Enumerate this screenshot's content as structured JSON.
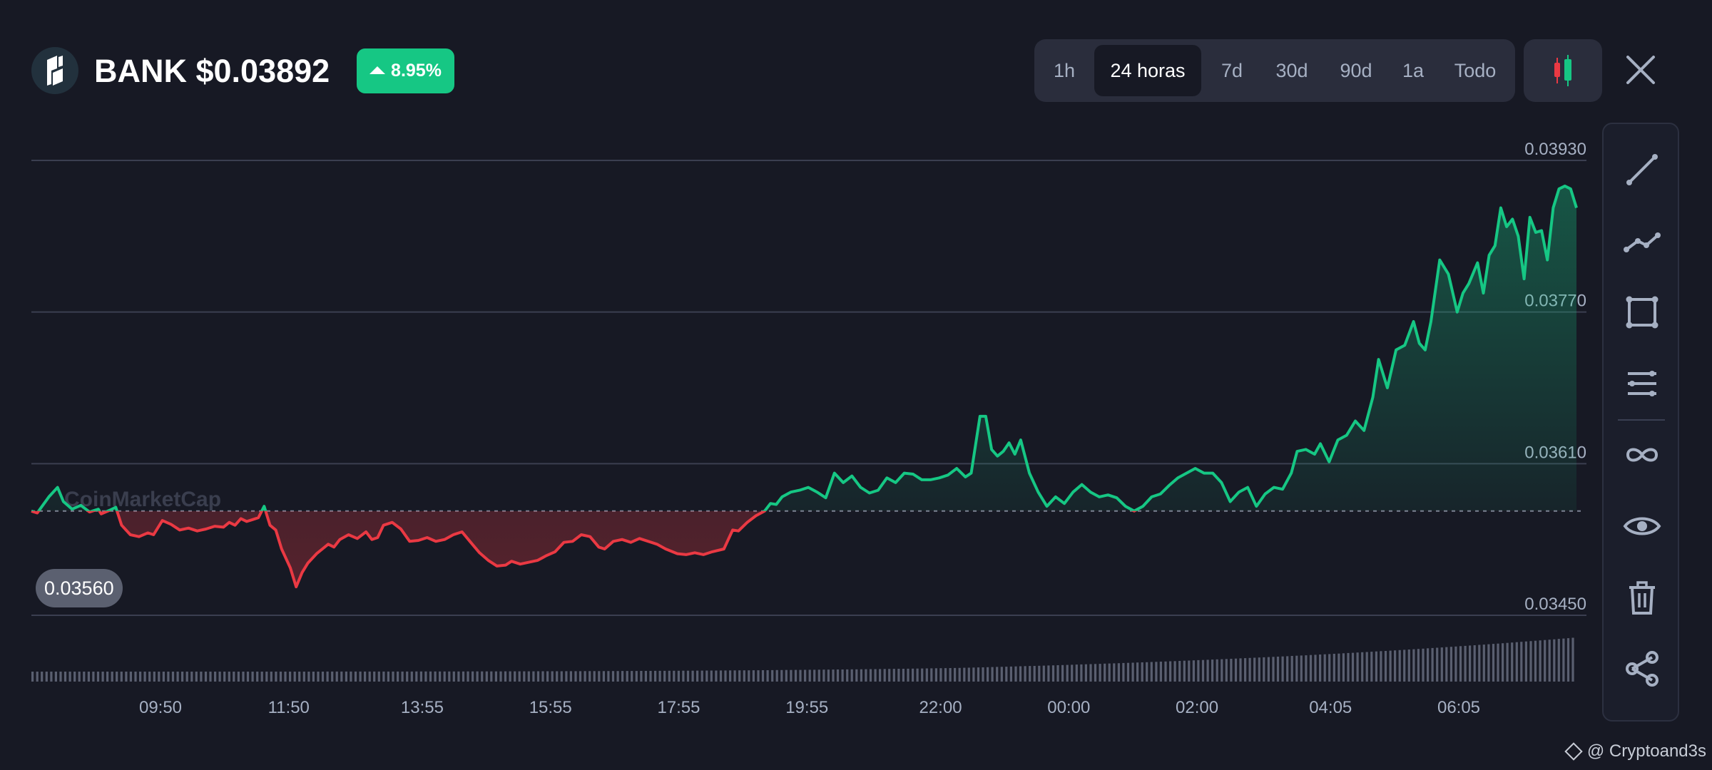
{
  "asset": {
    "ticker_price": "BANK $0.03892",
    "change": "8.95%",
    "logo_icon": "bank-logo-icon"
  },
  "range_tabs": [
    {
      "label": "1h",
      "active": false
    },
    {
      "label": "24 horas",
      "active": true
    },
    {
      "label": "7d",
      "active": false
    },
    {
      "label": "30d",
      "active": false
    },
    {
      "label": "90d",
      "active": false
    },
    {
      "label": "1a",
      "active": false
    },
    {
      "label": "Todo",
      "active": false
    }
  ],
  "controls": {
    "candle_icon": "candlestick-icon",
    "close_icon": "close-icon"
  },
  "toolbar": [
    "trend-line-icon",
    "polyline-icon",
    "rectangle-icon",
    "parallel-lines-icon",
    "infinity-icon",
    "eye-icon",
    "trash-icon",
    "share-icon"
  ],
  "chart_data": {
    "type": "area",
    "watermark": "CoinMarketCap",
    "baseline": 0.0356,
    "baseline_label": "0.03560",
    "y_ticks": [
      "0.03930",
      "0.03770",
      "0.03610",
      "0.03450"
    ],
    "y_tick_values": [
      0.0393,
      0.0377,
      0.0361,
      0.0345
    ],
    "ylim": [
      0.0345,
      0.0393
    ],
    "x_ticks": [
      "09:50",
      "11:50",
      "13:55",
      "15:55",
      "17:55",
      "19:55",
      "22:00",
      "00:00",
      "02:00",
      "04:05",
      "06:05"
    ],
    "x_tick_hours": [
      2,
      4,
      6.083,
      8.083,
      10.083,
      12.083,
      14.167,
      16.167,
      18.167,
      20.25,
      22.25
    ],
    "xlim_hours": [
      0,
      24
    ],
    "series": [
      {
        "points": [
          [
            0.0,
            0.0356
          ],
          [
            0.1,
            0.03558
          ],
          [
            0.3,
            0.03575
          ],
          [
            0.45,
            0.03585
          ],
          [
            0.55,
            0.0357
          ],
          [
            0.7,
            0.03562
          ],
          [
            0.85,
            0.03566
          ],
          [
            1.0,
            0.03559
          ],
          [
            1.15,
            0.03562
          ],
          [
            1.2,
            0.03557
          ],
          [
            1.35,
            0.03561
          ],
          [
            1.45,
            0.03564
          ],
          [
            1.55,
            0.03545
          ],
          [
            1.7,
            0.03535
          ],
          [
            1.85,
            0.03533
          ],
          [
            2.0,
            0.03537
          ],
          [
            2.1,
            0.03535
          ],
          [
            2.25,
            0.0355
          ],
          [
            2.4,
            0.03546
          ],
          [
            2.55,
            0.0354
          ],
          [
            2.7,
            0.03542
          ],
          [
            2.85,
            0.03539
          ],
          [
            3.0,
            0.03541
          ],
          [
            3.15,
            0.03544
          ],
          [
            3.3,
            0.03543
          ],
          [
            3.4,
            0.03548
          ],
          [
            3.5,
            0.03545
          ],
          [
            3.6,
            0.03552
          ],
          [
            3.7,
            0.03549
          ],
          [
            3.8,
            0.03551
          ],
          [
            3.9,
            0.03553
          ],
          [
            4.0,
            0.03565
          ],
          [
            4.1,
            0.03545
          ],
          [
            4.2,
            0.0354
          ],
          [
            4.3,
            0.0352
          ],
          [
            4.45,
            0.035
          ],
          [
            4.55,
            0.0348
          ],
          [
            4.65,
            0.03495
          ],
          [
            4.75,
            0.03505
          ],
          [
            4.9,
            0.03515
          ],
          [
            5.0,
            0.0352
          ],
          [
            5.1,
            0.03525
          ],
          [
            5.2,
            0.03522
          ],
          [
            5.3,
            0.0353
          ],
          [
            5.45,
            0.03535
          ],
          [
            5.6,
            0.03531
          ],
          [
            5.75,
            0.03538
          ],
          [
            5.85,
            0.0353
          ],
          [
            5.95,
            0.03532
          ],
          [
            6.05,
            0.03545
          ],
          [
            6.2,
            0.03548
          ],
          [
            6.35,
            0.03541
          ],
          [
            6.5,
            0.03528
          ],
          [
            6.65,
            0.03529
          ],
          [
            6.8,
            0.03532
          ],
          [
            6.95,
            0.03528
          ],
          [
            7.1,
            0.0353
          ],
          [
            7.25,
            0.03535
          ],
          [
            7.4,
            0.03538
          ],
          [
            7.55,
            0.03527
          ],
          [
            7.7,
            0.03516
          ],
          [
            7.85,
            0.03508
          ],
          [
            8.0,
            0.03502
          ],
          [
            8.15,
            0.03503
          ],
          [
            8.25,
            0.03507
          ],
          [
            8.4,
            0.03504
          ],
          [
            8.55,
            0.03506
          ],
          [
            8.7,
            0.03508
          ],
          [
            8.85,
            0.03513
          ],
          [
            9.0,
            0.03517
          ],
          [
            9.15,
            0.03527
          ],
          [
            9.3,
            0.03528
          ],
          [
            9.45,
            0.03535
          ],
          [
            9.6,
            0.03533
          ],
          [
            9.75,
            0.03522
          ],
          [
            9.85,
            0.0352
          ],
          [
            10.0,
            0.03528
          ],
          [
            10.15,
            0.0353
          ],
          [
            10.3,
            0.03527
          ],
          [
            10.45,
            0.03531
          ],
          [
            10.6,
            0.03528
          ],
          [
            10.75,
            0.03525
          ],
          [
            10.9,
            0.0352
          ],
          [
            11.1,
            0.03515
          ],
          [
            11.25,
            0.03514
          ],
          [
            11.4,
            0.03516
          ],
          [
            11.55,
            0.03514
          ],
          [
            11.7,
            0.03517
          ],
          [
            11.9,
            0.0352
          ],
          [
            12.05,
            0.0354
          ],
          [
            12.15,
            0.03539
          ],
          [
            12.3,
            0.03548
          ],
          [
            12.45,
            0.03555
          ],
          [
            12.6,
            0.0356
          ],
          [
            12.7,
            0.03568
          ],
          [
            12.8,
            0.03567
          ],
          [
            12.9,
            0.03575
          ],
          [
            13.05,
            0.0358
          ],
          [
            13.2,
            0.03582
          ],
          [
            13.35,
            0.03585
          ],
          [
            13.5,
            0.0358
          ],
          [
            13.65,
            0.03574
          ],
          [
            13.8,
            0.036
          ],
          [
            13.95,
            0.0359
          ],
          [
            14.1,
            0.03597
          ],
          [
            14.25,
            0.03585
          ],
          [
            14.4,
            0.03579
          ],
          [
            14.55,
            0.03582
          ],
          [
            14.7,
            0.03595
          ],
          [
            14.85,
            0.0359
          ],
          [
            15.0,
            0.036
          ],
          [
            15.15,
            0.03599
          ],
          [
            15.3,
            0.03593
          ],
          [
            15.45,
            0.03593
          ],
          [
            15.6,
            0.03595
          ],
          [
            15.75,
            0.03598
          ],
          [
            15.9,
            0.03605
          ],
          [
            16.05,
            0.03596
          ],
          [
            16.15,
            0.036
          ],
          [
            16.3,
            0.0366
          ],
          [
            16.4,
            0.0366
          ],
          [
            16.5,
            0.03625
          ],
          [
            16.6,
            0.03618
          ],
          [
            16.7,
            0.03623
          ],
          [
            16.8,
            0.03632
          ],
          [
            16.9,
            0.0362
          ],
          [
            17.0,
            0.03635
          ],
          [
            17.15,
            0.036
          ],
          [
            17.3,
            0.0358
          ],
          [
            17.45,
            0.03565
          ],
          [
            17.6,
            0.03575
          ],
          [
            17.75,
            0.03568
          ],
          [
            17.9,
            0.0358
          ],
          [
            18.05,
            0.03588
          ],
          [
            18.2,
            0.0358
          ],
          [
            18.35,
            0.03575
          ],
          [
            18.5,
            0.03577
          ],
          [
            18.65,
            0.03574
          ],
          [
            18.8,
            0.03565
          ],
          [
            18.95,
            0.0356
          ],
          [
            19.1,
            0.03565
          ],
          [
            19.25,
            0.03575
          ],
          [
            19.4,
            0.03578
          ],
          [
            19.55,
            0.03587
          ],
          [
            19.7,
            0.03595
          ],
          [
            19.85,
            0.036
          ],
          [
            20.0,
            0.03605
          ],
          [
            20.15,
            0.036
          ],
          [
            20.3,
            0.036
          ],
          [
            20.45,
            0.0359
          ],
          [
            20.6,
            0.0357
          ],
          [
            20.75,
            0.0358
          ],
          [
            20.9,
            0.03585
          ],
          [
            21.05,
            0.03565
          ],
          [
            21.2,
            0.03578
          ],
          [
            21.35,
            0.03585
          ],
          [
            21.5,
            0.03583
          ],
          [
            21.65,
            0.036
          ],
          [
            21.75,
            0.03623
          ],
          [
            21.9,
            0.03625
          ],
          [
            22.05,
            0.0362
          ],
          [
            22.15,
            0.03631
          ],
          [
            22.3,
            0.03612
          ],
          [
            22.45,
            0.03635
          ],
          [
            22.6,
            0.0364
          ],
          [
            22.75,
            0.03655
          ],
          [
            22.9,
            0.03645
          ],
          [
            23.05,
            0.0368
          ],
          [
            23.15,
            0.0372
          ],
          [
            23.3,
            0.0369
          ],
          [
            23.45,
            0.0373
          ],
          [
            23.6,
            0.03735
          ],
          [
            23.75,
            0.0376
          ],
          [
            23.85,
            0.03737
          ],
          [
            23.95,
            0.0373
          ],
          [
            24.05,
            0.0376
          ],
          [
            24.2,
            0.03825
          ],
          [
            24.35,
            0.0381
          ],
          [
            24.5,
            0.0377
          ],
          [
            24.6,
            0.0379
          ],
          [
            24.7,
            0.038
          ],
          [
            24.85,
            0.03822
          ],
          [
            24.95,
            0.0379
          ],
          [
            25.05,
            0.0383
          ],
          [
            25.15,
            0.0384
          ],
          [
            25.25,
            0.0388
          ],
          [
            25.35,
            0.0386
          ],
          [
            25.45,
            0.03868
          ],
          [
            25.55,
            0.0385
          ],
          [
            25.65,
            0.03805
          ],
          [
            25.75,
            0.0387
          ],
          [
            25.85,
            0.03854
          ],
          [
            25.95,
            0.03856
          ],
          [
            26.05,
            0.03825
          ],
          [
            26.15,
            0.0388
          ],
          [
            26.25,
            0.039
          ],
          [
            26.35,
            0.03903
          ],
          [
            26.45,
            0.039
          ],
          [
            26.55,
            0.0388
          ]
        ]
      }
    ]
  },
  "credit": {
    "text": "@ Cryptoand3s",
    "icon": "binance-diamond-icon"
  }
}
